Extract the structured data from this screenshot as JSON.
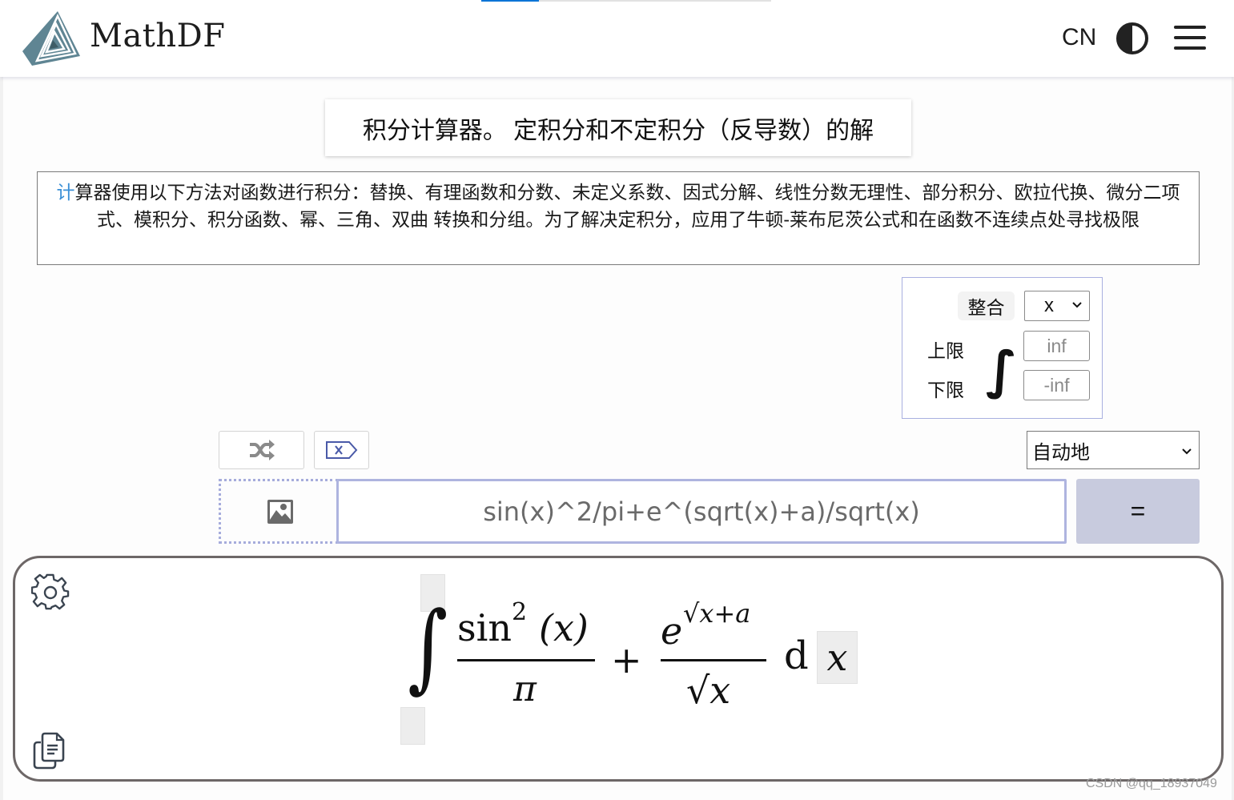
{
  "header": {
    "brand": "MathDF",
    "language_button": "CN",
    "theme_toggle_icon": "half-circle-contrast-icon",
    "menu_icon": "hamburger-menu-icon",
    "page_load_progress": 0.2
  },
  "title": "积分计算器。 定积分和不定积分（反导数）的解",
  "description": {
    "first_char": "计",
    "rest": "算器使用以下方法对函数进行积分：替换、有理函数和分数、未定义系数、因式分解、线性分数无理性、部分积分、欧拉代换、微分二项式、模积分、积分函数、幂、三角、双曲 转换和分组。为了解决定积分，应用了牛顿-莱布尼茨公式和在函数不连续点处寻找极限"
  },
  "integration": {
    "integrate_label": "整合",
    "variable_selected": "x",
    "upper_label": "上限",
    "lower_label": "下限",
    "integral_symbol": "∫",
    "upper_placeholder": "inf",
    "lower_placeholder": "-inf"
  },
  "toolbar": {
    "shuffle_icon": "shuffle-random-icon",
    "clear_icon": "backspace-clear-icon",
    "mode_selected": "自动地"
  },
  "input": {
    "image_upload_icon": "image-icon",
    "expression": "sin(x)^2/pi+e^(sqrt(x)+a)/sqrt(x)",
    "submit_label": "="
  },
  "result": {
    "settings_icon": "gear-icon",
    "copy_icon": "copy-document-icon",
    "formula": {
      "integral": "∫",
      "term1_numerator_func": "sin",
      "term1_numerator_power": "2",
      "term1_numerator_arg": "(x)",
      "term1_denominator": "π",
      "plus": "+",
      "term2_numerator_base": "e",
      "term2_numerator_exponent": "√x+a",
      "term2_denominator": "√x",
      "differential": "d",
      "variable": "x"
    }
  },
  "watermark": "CSDN @qq_18937049",
  "colors": {
    "accent_blue": "#0a74d6",
    "input_border": "#aeb4df",
    "equals_button": "#c8cbde",
    "logo": "#5f8593"
  }
}
